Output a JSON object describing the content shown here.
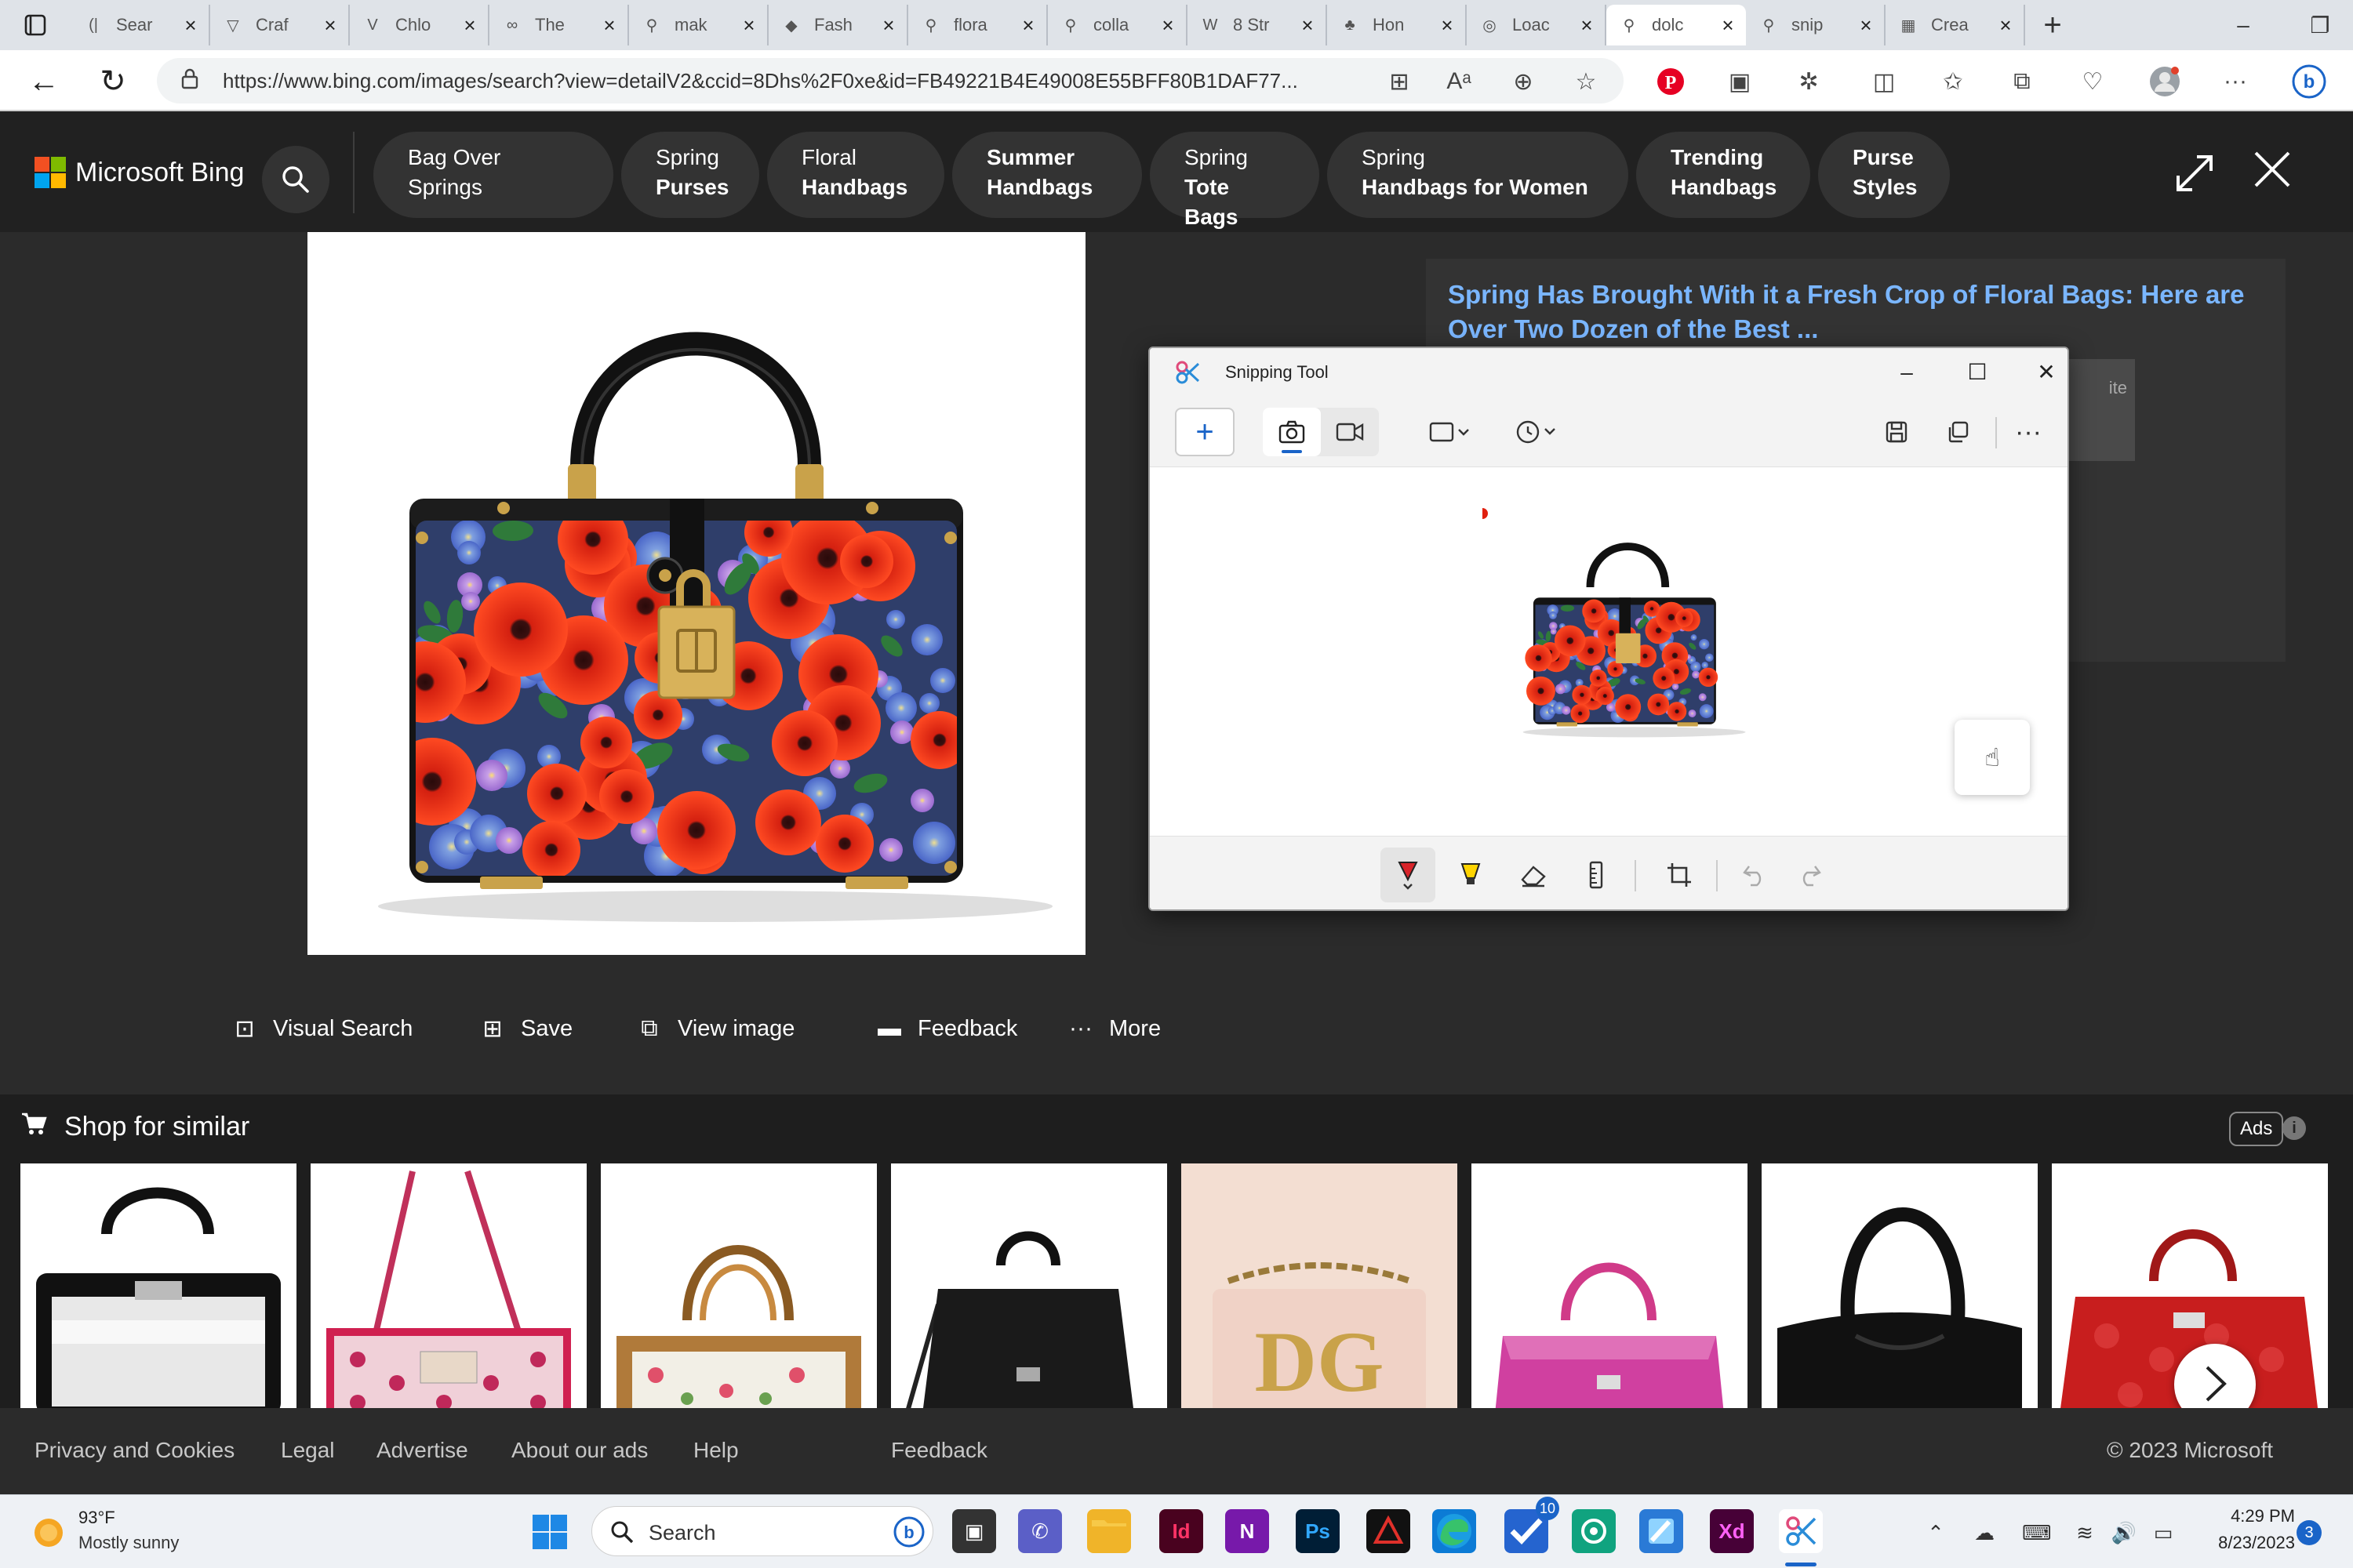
{
  "browser": {
    "tabs": [
      {
        "label": "Sear",
        "icon": "page-icon"
      },
      {
        "label": "Craf",
        "icon": "vector-logo-icon"
      },
      {
        "label": "Chlo",
        "icon": "v-logo-icon"
      },
      {
        "label": "The",
        "icon": "infinity-icon"
      },
      {
        "label": "mak",
        "icon": "search-icon"
      },
      {
        "label": "Fash",
        "icon": "tag-icon"
      },
      {
        "label": "flora",
        "icon": "search-icon"
      },
      {
        "label": "colla",
        "icon": "search-icon"
      },
      {
        "label": "8 Str",
        "icon": "w-logo-icon"
      },
      {
        "label": "Hon",
        "icon": "fox-logo-icon"
      },
      {
        "label": "Loac",
        "icon": "openai-icon"
      },
      {
        "label": "dolc",
        "icon": "search-icon",
        "active": true
      },
      {
        "label": "snip",
        "icon": "search-icon"
      },
      {
        "label": "Crea",
        "icon": "microsoft-icon"
      }
    ],
    "url": "https://www.bing.com/images/search?view=detailV2&ccid=8Dhs%2F0xe&id=FB49221B4E49008E55BFF80B1DAF77..."
  },
  "bing": {
    "logo_text": "Microsoft Bing",
    "colors": {
      "red": "#f25022",
      "green": "#7fba00",
      "blue": "#00a4ef",
      "yellow": "#ffb900",
      "link": "#7ab6ff"
    },
    "chips": [
      {
        "line1": "Bag Over Springs",
        "line2": ""
      },
      {
        "line1": "Spring",
        "line2": "Purses"
      },
      {
        "line1": "Floral",
        "line2": "Handbags"
      },
      {
        "line1": "Summer",
        "line2": "Handbags"
      },
      {
        "line1": "Spring",
        "line2": "Tote Bags"
      },
      {
        "line1": "Spring",
        "line2": "Handbags for Women"
      },
      {
        "line1": "Trending",
        "line2": "Handbags"
      },
      {
        "line1": "Purse",
        "line2": "Styles"
      }
    ]
  },
  "result": {
    "title": "Spring Has Brought With it a Fresh Crop of Floral Bags: Here are Over Two Dozen of the Best ...",
    "side_fragment": "ite"
  },
  "snipping_tool": {
    "title": "Snipping Tool"
  },
  "actions": [
    {
      "label": "Visual Search",
      "icon": "visual-search-icon"
    },
    {
      "label": "Save",
      "icon": "save-icon"
    },
    {
      "label": "View image",
      "icon": "view-image-icon"
    },
    {
      "label": "Feedback",
      "icon": "feedback-icon"
    },
    {
      "label": "More",
      "icon": "more-icon"
    }
  ],
  "shop": {
    "title": "Shop for similar",
    "ads_label": "Ads"
  },
  "footer": {
    "links": [
      "Privacy and Cookies",
      "Legal",
      "Advertise",
      "About our ads",
      "Help",
      "Feedback"
    ],
    "copyright": "© 2023 Microsoft"
  },
  "taskbar": {
    "weather_temp": "93°F",
    "weather_desc": "Mostly sunny",
    "search_placeholder": "Search",
    "time": "4:29 PM",
    "date": "8/23/2023",
    "notification_count": "3",
    "badge_count": "10",
    "apps": [
      {
        "name": "file-explorer",
        "label": "",
        "color": "#f0b429"
      },
      {
        "name": "indesign",
        "label": "Id",
        "color": "#49021f"
      },
      {
        "name": "onenote",
        "label": "N",
        "color": "#7719aa"
      },
      {
        "name": "photoshop",
        "label": "Ps",
        "color": "#001e36"
      },
      {
        "name": "acrobat",
        "label": "A",
        "color": "#111111"
      },
      {
        "name": "edge",
        "label": "",
        "color": "#0c7bd5"
      },
      {
        "name": "todo",
        "label": "",
        "color": "#2564cf"
      },
      {
        "name": "chatgpt",
        "label": "",
        "color": "#10a37f"
      },
      {
        "name": "paint",
        "label": "",
        "color": "#2a7ad6"
      },
      {
        "name": "xd",
        "label": "Xd",
        "color": "#470137"
      },
      {
        "name": "snipping-tool",
        "label": "",
        "color": "#ffffff"
      }
    ]
  }
}
